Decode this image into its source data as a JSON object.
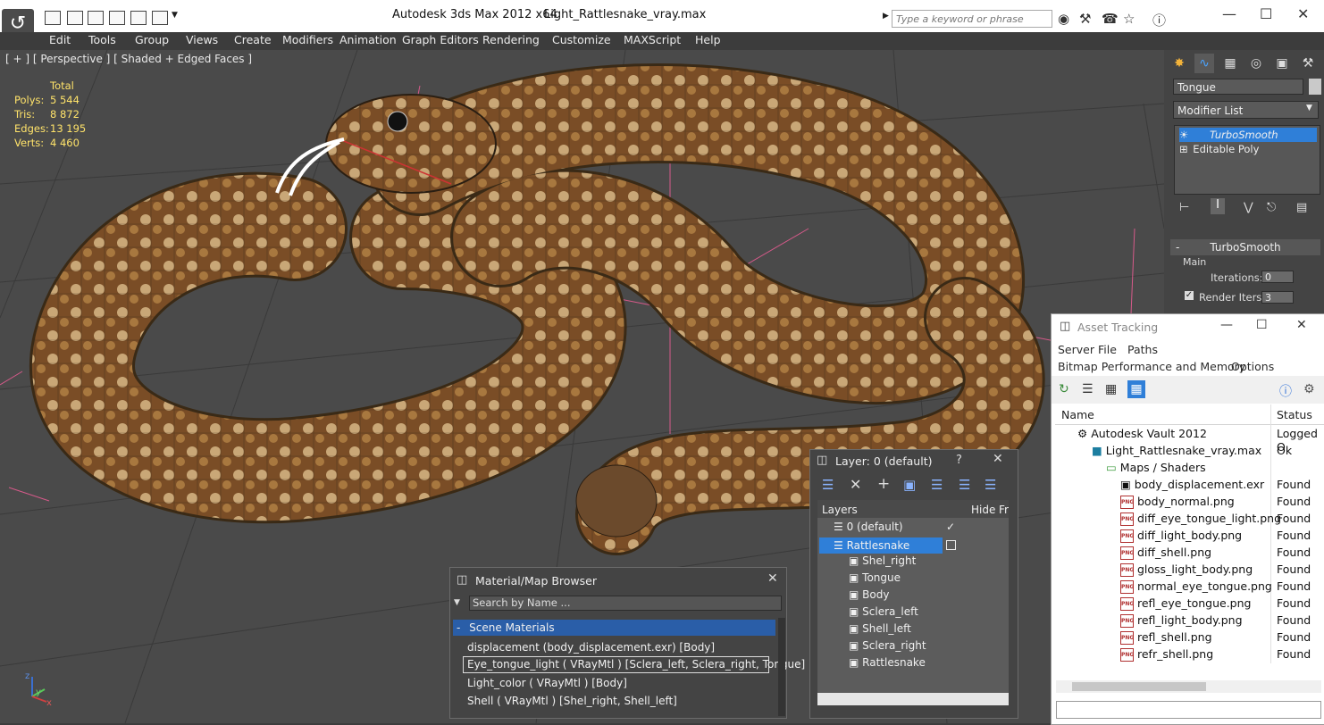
{
  "titlebar": {
    "app_title": "Autodesk 3ds Max  2012 x64",
    "file_name": "Light_Rattlesnake_vray.max",
    "search_placeholder": "Type a keyword or phrase"
  },
  "menubar": [
    "Edit",
    "Tools",
    "Group",
    "Views",
    "Create",
    "Modifiers",
    "Animation",
    "Graph Editors",
    "Rendering",
    "Customize",
    "MAXScript",
    "Help"
  ],
  "viewport": {
    "label": "[ + ] [ Perspective ] [ Shaded + Edged Faces ]",
    "stats_header": "Total",
    "stats": [
      {
        "label": "Polys:",
        "value": "5 544"
      },
      {
        "label": "Tris:",
        "value": "8 872"
      },
      {
        "label": "Edges:",
        "value": "13 195"
      },
      {
        "label": "Verts:",
        "value": "4 460"
      }
    ],
    "axis_labels": [
      "z",
      "y",
      "x"
    ]
  },
  "command_panel": {
    "object_name": "Tongue",
    "modifier_list": "Modifier List",
    "stack": [
      "TurboSmooth",
      "Editable Poly"
    ],
    "rollout_title": "TurboSmooth",
    "group_main": "Main",
    "iterations_label": "Iterations:",
    "iterations_value": "0",
    "render_iters_label": "Render Iters:",
    "render_iters_value": "3"
  },
  "material_browser": {
    "title": "Material/Map Browser",
    "search_placeholder": "Search by Name ...",
    "group": "Scene Materials",
    "items": [
      "displacement (body_displacement.exr) [Body]",
      "Eye_tongue_light  ( VRayMtl )  [Sclera_left, Sclera_right, Tongue]",
      "Light_color  ( VRayMtl )  [Body]",
      "Shell  ( VRayMtl )  [Shel_right, Shell_left]"
    ]
  },
  "layer_dialog": {
    "title": "Layer: 0 (default)",
    "help": "?",
    "columns": [
      "Layers",
      "Hide",
      "Fr"
    ],
    "layers": [
      {
        "name": "0 (default)",
        "level": 0
      },
      {
        "name": "Rattlesnake",
        "level": 0
      },
      {
        "name": "Shel_right",
        "level": 1
      },
      {
        "name": "Tongue",
        "level": 1
      },
      {
        "name": "Body",
        "level": 1
      },
      {
        "name": "Sclera_left",
        "level": 1
      },
      {
        "name": "Shell_left",
        "level": 1
      },
      {
        "name": "Sclera_right",
        "level": 1
      },
      {
        "name": "Rattlesnake",
        "level": 1
      }
    ]
  },
  "asset_tracking": {
    "title": "Asset Tracking",
    "menu_row1": [
      "Server",
      "File",
      "Paths"
    ],
    "menu_row2": [
      "Bitmap Performance and Memory",
      "Options"
    ],
    "columns": [
      "Name",
      "Status"
    ],
    "rows": [
      {
        "name": "Autodesk Vault 2012",
        "status": "Logged O",
        "indent": 0,
        "icon": "vault"
      },
      {
        "name": "Light_Rattlesnake_vray.max",
        "status": "Ok",
        "indent": 1,
        "icon": "max"
      },
      {
        "name": "Maps / Shaders",
        "status": "",
        "indent": 2,
        "icon": "folder"
      },
      {
        "name": "body_displacement.exr",
        "status": "Found",
        "indent": 3,
        "icon": "exr"
      },
      {
        "name": "body_normal.png",
        "status": "Found",
        "indent": 3,
        "icon": "png"
      },
      {
        "name": "diff_eye_tongue_light.png",
        "status": "Found",
        "indent": 3,
        "icon": "png"
      },
      {
        "name": "diff_light_body.png",
        "status": "Found",
        "indent": 3,
        "icon": "png"
      },
      {
        "name": "diff_shell.png",
        "status": "Found",
        "indent": 3,
        "icon": "png"
      },
      {
        "name": "gloss_light_body.png",
        "status": "Found",
        "indent": 3,
        "icon": "png"
      },
      {
        "name": "normal_eye_tongue.png",
        "status": "Found",
        "indent": 3,
        "icon": "png"
      },
      {
        "name": "refl_eye_tongue.png",
        "status": "Found",
        "indent": 3,
        "icon": "png"
      },
      {
        "name": "refl_light_body.png",
        "status": "Found",
        "indent": 3,
        "icon": "png"
      },
      {
        "name": "refl_shell.png",
        "status": "Found",
        "indent": 3,
        "icon": "png"
      },
      {
        "name": "refr_shell.png",
        "status": "Found",
        "indent": 3,
        "icon": "png"
      }
    ],
    "png_label": "PNG"
  },
  "colors": {
    "viewport_bg": "#4a4a4a",
    "grid": "#3a3a3a",
    "stats_text": "#ffe36a",
    "selection_blue": "#2f7fd8",
    "snake_dark": "#6b4320",
    "snake_light": "#c9a777"
  }
}
